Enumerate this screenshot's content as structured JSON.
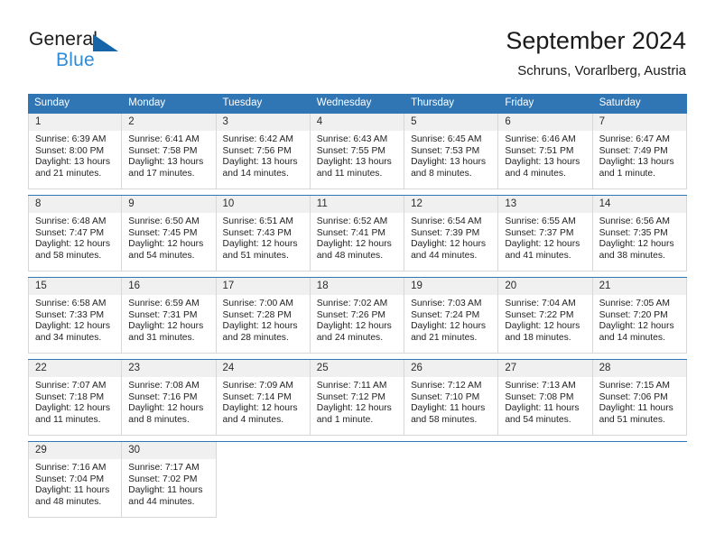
{
  "brand": {
    "name_top": "General",
    "name_bottom": "Blue",
    "accent_color": "#2e8bd6",
    "triangle_color": "#1565a8"
  },
  "header": {
    "title": "September 2024",
    "subtitle": "Schruns, Vorarlberg, Austria"
  },
  "calendar": {
    "header_bg": "#3076b5",
    "header_text_color": "#ffffff",
    "day_number_bg": "#f0f0f0",
    "weekdays": [
      "Sunday",
      "Monday",
      "Tuesday",
      "Wednesday",
      "Thursday",
      "Friday",
      "Saturday"
    ],
    "weeks": [
      [
        {
          "day": "1",
          "sunrise": "Sunrise: 6:39 AM",
          "sunset": "Sunset: 8:00 PM",
          "daylight1": "Daylight: 13 hours",
          "daylight2": "and 21 minutes."
        },
        {
          "day": "2",
          "sunrise": "Sunrise: 6:41 AM",
          "sunset": "Sunset: 7:58 PM",
          "daylight1": "Daylight: 13 hours",
          "daylight2": "and 17 minutes."
        },
        {
          "day": "3",
          "sunrise": "Sunrise: 6:42 AM",
          "sunset": "Sunset: 7:56 PM",
          "daylight1": "Daylight: 13 hours",
          "daylight2": "and 14 minutes."
        },
        {
          "day": "4",
          "sunrise": "Sunrise: 6:43 AM",
          "sunset": "Sunset: 7:55 PM",
          "daylight1": "Daylight: 13 hours",
          "daylight2": "and 11 minutes."
        },
        {
          "day": "5",
          "sunrise": "Sunrise: 6:45 AM",
          "sunset": "Sunset: 7:53 PM",
          "daylight1": "Daylight: 13 hours",
          "daylight2": "and 8 minutes."
        },
        {
          "day": "6",
          "sunrise": "Sunrise: 6:46 AM",
          "sunset": "Sunset: 7:51 PM",
          "daylight1": "Daylight: 13 hours",
          "daylight2": "and 4 minutes."
        },
        {
          "day": "7",
          "sunrise": "Sunrise: 6:47 AM",
          "sunset": "Sunset: 7:49 PM",
          "daylight1": "Daylight: 13 hours",
          "daylight2": "and 1 minute."
        }
      ],
      [
        {
          "day": "8",
          "sunrise": "Sunrise: 6:48 AM",
          "sunset": "Sunset: 7:47 PM",
          "daylight1": "Daylight: 12 hours",
          "daylight2": "and 58 minutes."
        },
        {
          "day": "9",
          "sunrise": "Sunrise: 6:50 AM",
          "sunset": "Sunset: 7:45 PM",
          "daylight1": "Daylight: 12 hours",
          "daylight2": "and 54 minutes."
        },
        {
          "day": "10",
          "sunrise": "Sunrise: 6:51 AM",
          "sunset": "Sunset: 7:43 PM",
          "daylight1": "Daylight: 12 hours",
          "daylight2": "and 51 minutes."
        },
        {
          "day": "11",
          "sunrise": "Sunrise: 6:52 AM",
          "sunset": "Sunset: 7:41 PM",
          "daylight1": "Daylight: 12 hours",
          "daylight2": "and 48 minutes."
        },
        {
          "day": "12",
          "sunrise": "Sunrise: 6:54 AM",
          "sunset": "Sunset: 7:39 PM",
          "daylight1": "Daylight: 12 hours",
          "daylight2": "and 44 minutes."
        },
        {
          "day": "13",
          "sunrise": "Sunrise: 6:55 AM",
          "sunset": "Sunset: 7:37 PM",
          "daylight1": "Daylight: 12 hours",
          "daylight2": "and 41 minutes."
        },
        {
          "day": "14",
          "sunrise": "Sunrise: 6:56 AM",
          "sunset": "Sunset: 7:35 PM",
          "daylight1": "Daylight: 12 hours",
          "daylight2": "and 38 minutes."
        }
      ],
      [
        {
          "day": "15",
          "sunrise": "Sunrise: 6:58 AM",
          "sunset": "Sunset: 7:33 PM",
          "daylight1": "Daylight: 12 hours",
          "daylight2": "and 34 minutes."
        },
        {
          "day": "16",
          "sunrise": "Sunrise: 6:59 AM",
          "sunset": "Sunset: 7:31 PM",
          "daylight1": "Daylight: 12 hours",
          "daylight2": "and 31 minutes."
        },
        {
          "day": "17",
          "sunrise": "Sunrise: 7:00 AM",
          "sunset": "Sunset: 7:28 PM",
          "daylight1": "Daylight: 12 hours",
          "daylight2": "and 28 minutes."
        },
        {
          "day": "18",
          "sunrise": "Sunrise: 7:02 AM",
          "sunset": "Sunset: 7:26 PM",
          "daylight1": "Daylight: 12 hours",
          "daylight2": "and 24 minutes."
        },
        {
          "day": "19",
          "sunrise": "Sunrise: 7:03 AM",
          "sunset": "Sunset: 7:24 PM",
          "daylight1": "Daylight: 12 hours",
          "daylight2": "and 21 minutes."
        },
        {
          "day": "20",
          "sunrise": "Sunrise: 7:04 AM",
          "sunset": "Sunset: 7:22 PM",
          "daylight1": "Daylight: 12 hours",
          "daylight2": "and 18 minutes."
        },
        {
          "day": "21",
          "sunrise": "Sunrise: 7:05 AM",
          "sunset": "Sunset: 7:20 PM",
          "daylight1": "Daylight: 12 hours",
          "daylight2": "and 14 minutes."
        }
      ],
      [
        {
          "day": "22",
          "sunrise": "Sunrise: 7:07 AM",
          "sunset": "Sunset: 7:18 PM",
          "daylight1": "Daylight: 12 hours",
          "daylight2": "and 11 minutes."
        },
        {
          "day": "23",
          "sunrise": "Sunrise: 7:08 AM",
          "sunset": "Sunset: 7:16 PM",
          "daylight1": "Daylight: 12 hours",
          "daylight2": "and 8 minutes."
        },
        {
          "day": "24",
          "sunrise": "Sunrise: 7:09 AM",
          "sunset": "Sunset: 7:14 PM",
          "daylight1": "Daylight: 12 hours",
          "daylight2": "and 4 minutes."
        },
        {
          "day": "25",
          "sunrise": "Sunrise: 7:11 AM",
          "sunset": "Sunset: 7:12 PM",
          "daylight1": "Daylight: 12 hours",
          "daylight2": "and 1 minute."
        },
        {
          "day": "26",
          "sunrise": "Sunrise: 7:12 AM",
          "sunset": "Sunset: 7:10 PM",
          "daylight1": "Daylight: 11 hours",
          "daylight2": "and 58 minutes."
        },
        {
          "day": "27",
          "sunrise": "Sunrise: 7:13 AM",
          "sunset": "Sunset: 7:08 PM",
          "daylight1": "Daylight: 11 hours",
          "daylight2": "and 54 minutes."
        },
        {
          "day": "28",
          "sunrise": "Sunrise: 7:15 AM",
          "sunset": "Sunset: 7:06 PM",
          "daylight1": "Daylight: 11 hours",
          "daylight2": "and 51 minutes."
        }
      ],
      [
        {
          "day": "29",
          "sunrise": "Sunrise: 7:16 AM",
          "sunset": "Sunset: 7:04 PM",
          "daylight1": "Daylight: 11 hours",
          "daylight2": "and 48 minutes."
        },
        {
          "day": "30",
          "sunrise": "Sunrise: 7:17 AM",
          "sunset": "Sunset: 7:02 PM",
          "daylight1": "Daylight: 11 hours",
          "daylight2": "and 44 minutes."
        },
        {
          "day": "",
          "sunrise": "",
          "sunset": "",
          "daylight1": "",
          "daylight2": ""
        },
        {
          "day": "",
          "sunrise": "",
          "sunset": "",
          "daylight1": "",
          "daylight2": ""
        },
        {
          "day": "",
          "sunrise": "",
          "sunset": "",
          "daylight1": "",
          "daylight2": ""
        },
        {
          "day": "",
          "sunrise": "",
          "sunset": "",
          "daylight1": "",
          "daylight2": ""
        },
        {
          "day": "",
          "sunrise": "",
          "sunset": "",
          "daylight1": "",
          "daylight2": ""
        }
      ]
    ]
  }
}
